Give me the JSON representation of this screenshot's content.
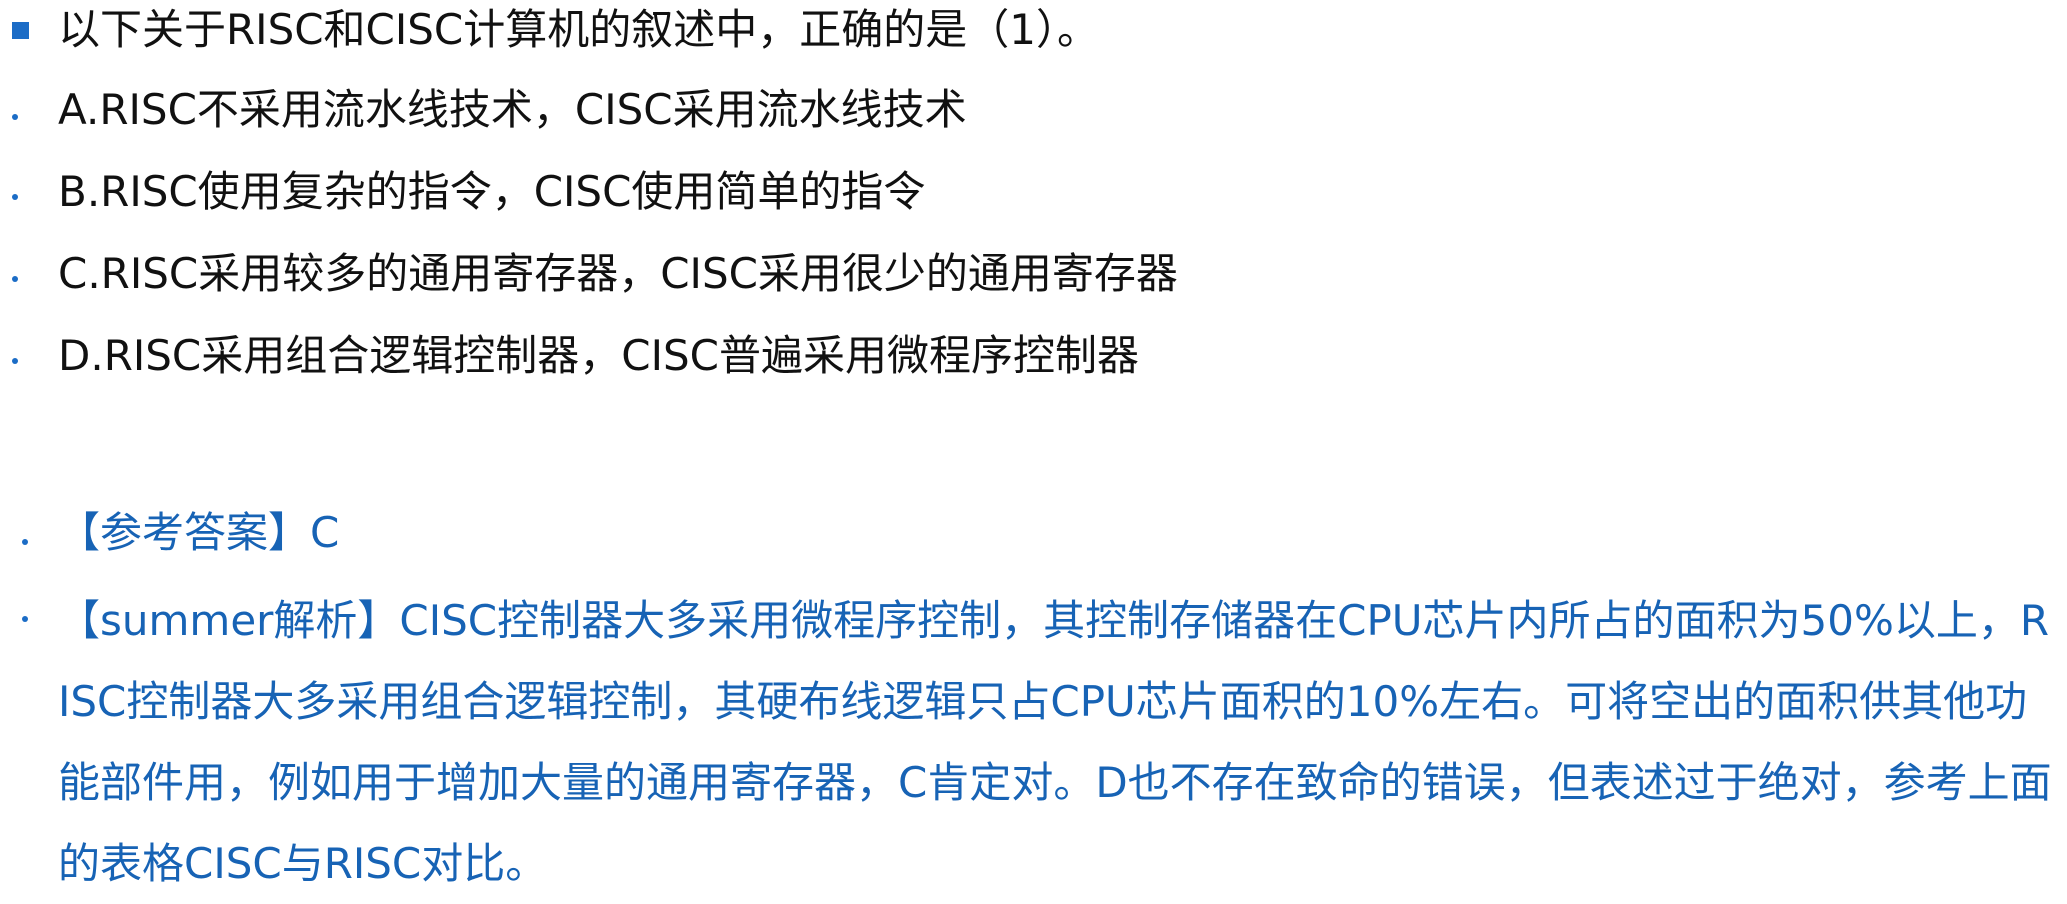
{
  "question": {
    "stem": "以下关于RISC和CISC计算机的叙述中，正确的是（1）。",
    "options": [
      "A.RISC不采用流水线技术，CISC采用流水线技术",
      "B.RISC使用复杂的指令，CISC使用简单的指令",
      "C.RISC采用较多的通用寄存器，CISC采用很少的通用寄存器",
      "D.RISC采用组合逻辑控制器，CISC普遍采用微程序控制器"
    ]
  },
  "answer": {
    "reference": "【参考答案】C",
    "analysis": "【summer解析】CISC控制器大多采用微程序控制，其控制存储器在CPU芯片内所占的面积为50%以上，RISC控制器大多采用组合逻辑控制，其硬布线逻辑只占CPU芯片面积的10%左右。可将空出的面积供其他功能部件用，例如用于增加大量的通用寄存器，C肯定对。D也不存在致命的错误，但表述过于绝对，参考上面的表格CISC与RISC对比。"
  },
  "colors": {
    "bullet": "#1b6cc6",
    "answer_text": "#1763b5",
    "body_text": "#111111"
  }
}
